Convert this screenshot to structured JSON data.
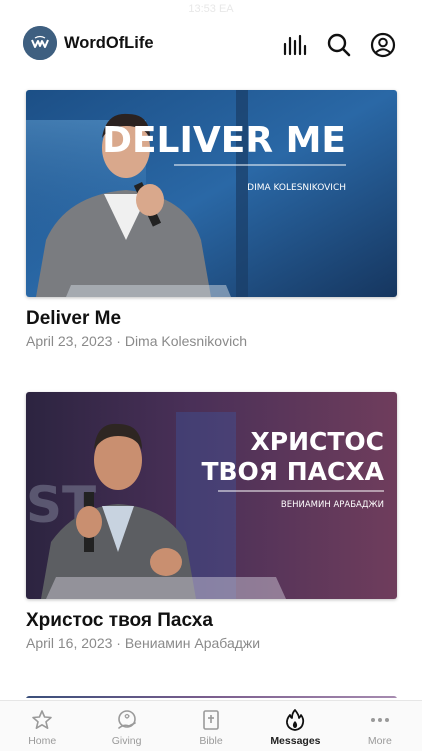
{
  "status": {
    "time": "13:53 EA"
  },
  "header": {
    "app_title": "WordOfLife"
  },
  "messages": [
    {
      "thumb_title": "DELIVER ME",
      "thumb_speaker": "DIMA KOLESNIKOVICH",
      "title": "Deliver Me",
      "meta": "April 23, 2023 · Dima Kolesnikovich"
    },
    {
      "thumb_title_line1": "ХРИСТОС",
      "thumb_title_line2": "ТВОЯ ПАСХА",
      "thumb_speaker": "ВЕНИАМИН АРАБАДЖИ",
      "thumb_bg_text": "ST",
      "title": "Христос твоя Пасха",
      "meta": "April 16, 2023 · Вениамин Арабаджи"
    }
  ],
  "tabs": [
    {
      "label": "Home",
      "icon": "star-icon"
    },
    {
      "label": "Giving",
      "icon": "giving-icon"
    },
    {
      "label": "Bible",
      "icon": "bible-icon"
    },
    {
      "label": "Messages",
      "icon": "flame-icon",
      "active": true
    },
    {
      "label": "More",
      "icon": "more-icon"
    }
  ],
  "colors": {
    "accent": "#111111",
    "muted": "#9a9a9a",
    "logo_bg": "#3a5a7a"
  }
}
